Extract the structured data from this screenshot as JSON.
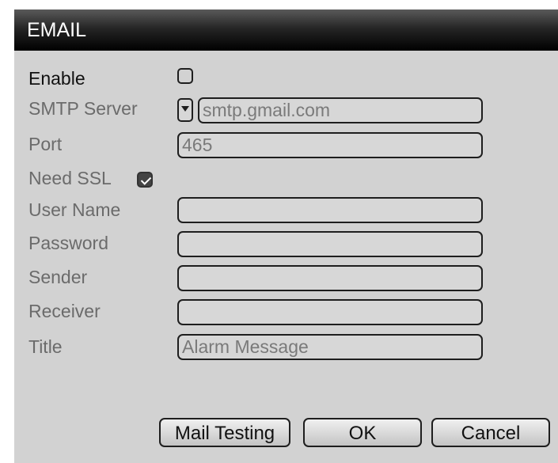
{
  "dialog": {
    "title": "EMAIL"
  },
  "form": {
    "enable": {
      "label": "Enable",
      "checked": false
    },
    "smtp_server": {
      "label": "SMTP Server",
      "value": "smtp.gmail.com"
    },
    "port": {
      "label": "Port",
      "value": "465"
    },
    "need_ssl": {
      "label": "Need SSL",
      "checked": true
    },
    "user_name": {
      "label": "User Name",
      "value": ""
    },
    "password": {
      "label": "Password",
      "value": ""
    },
    "sender": {
      "label": "Sender",
      "value": ""
    },
    "receiver": {
      "label": "Receiver",
      "value": ""
    },
    "title": {
      "label": "Title",
      "value": "Alarm Message"
    }
  },
  "buttons": {
    "mail_testing": "Mail Testing",
    "ok": "OK",
    "cancel": "Cancel"
  },
  "colors": {
    "title_bar": "#000000",
    "panel_background": "#d2d2d2",
    "active_label": "#111111",
    "inactive_label": "#6b6b6b"
  },
  "icons": {
    "dropdown": "chevron-down-icon",
    "checked": "checkmark-icon"
  }
}
